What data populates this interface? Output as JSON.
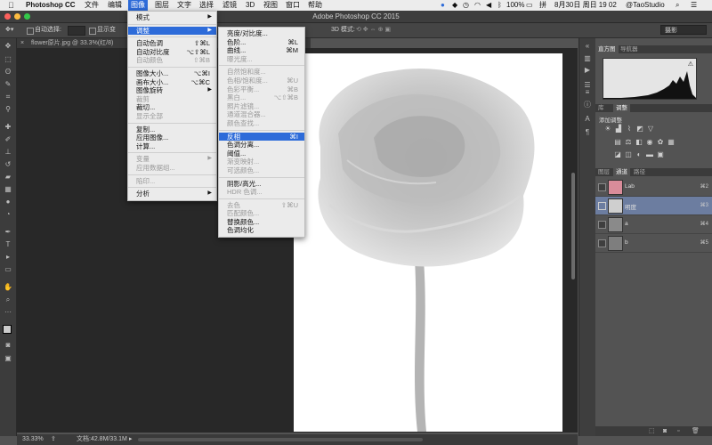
{
  "menubar": {
    "app_name": "Photoshop CC",
    "items": [
      "文件",
      "编辑",
      "图像",
      "图层",
      "文字",
      "选择",
      "滤镜",
      "3D",
      "视图",
      "窗口",
      "帮助"
    ],
    "status_text": "100%",
    "date_time": "8月30日 周日 19 02",
    "user": "@TaoStudio"
  },
  "titlebar": {
    "title": "Adobe Photoshop CC 2015"
  },
  "optionsbar": {
    "auto_select": "自动选择:",
    "show_transform": "显示变",
    "mode_3d": "3D 模式:",
    "workspace": "摄影"
  },
  "document": {
    "tab_label": "flower原片.jpg @ 33.3%(红/8)"
  },
  "statusbar": {
    "zoom": "33.33%",
    "doc_size": "文档:42.8M/33.1M"
  },
  "image_menu": {
    "items": [
      {
        "label": "模式",
        "shortcut": "",
        "submenu": true,
        "disabled": false,
        "sep_after": true
      },
      {
        "label": "调整",
        "shortcut": "",
        "submenu": true,
        "disabled": false,
        "highlight": true,
        "sep_after": true
      },
      {
        "label": "自动色调",
        "shortcut": "⇧⌘L"
      },
      {
        "label": "自动对比度",
        "shortcut": "⌥⇧⌘L"
      },
      {
        "label": "自动颜色",
        "shortcut": "⇧⌘B",
        "disabled": true,
        "sep_after": true
      },
      {
        "label": "图像大小...",
        "shortcut": "⌥⌘I"
      },
      {
        "label": "画布大小...",
        "shortcut": "⌥⌘C"
      },
      {
        "label": "图像旋转",
        "submenu": true
      },
      {
        "label": "裁剪",
        "disabled": true
      },
      {
        "label": "裁切..."
      },
      {
        "label": "显示全部",
        "disabled": true,
        "sep_after": true
      },
      {
        "label": "复制..."
      },
      {
        "label": "应用图像..."
      },
      {
        "label": "计算...",
        "sep_after": true
      },
      {
        "label": "变量",
        "submenu": true,
        "disabled": true
      },
      {
        "label": "应用数据组...",
        "disabled": true,
        "sep_after": true
      },
      {
        "label": "陷印...",
        "disabled": true,
        "sep_after": true
      },
      {
        "label": "分析",
        "submenu": true
      }
    ]
  },
  "adjust_menu": {
    "items": [
      {
        "label": "亮度/对比度..."
      },
      {
        "label": "色阶...",
        "shortcut": "⌘L"
      },
      {
        "label": "曲线...",
        "shortcut": "⌘M"
      },
      {
        "label": "曝光度...",
        "disabled": true,
        "sep_after": true
      },
      {
        "label": "自然饱和度...",
        "disabled": true
      },
      {
        "label": "色相/饱和度...",
        "shortcut": "⌘U",
        "disabled": true
      },
      {
        "label": "色彩平衡...",
        "shortcut": "⌘B",
        "disabled": true
      },
      {
        "label": "黑白...",
        "shortcut": "⌥⇧⌘B",
        "disabled": true
      },
      {
        "label": "照片滤镜...",
        "disabled": true
      },
      {
        "label": "通道混合器...",
        "disabled": true
      },
      {
        "label": "颜色查找...",
        "disabled": true,
        "sep_after": true
      },
      {
        "label": "反相",
        "shortcut": "⌘I",
        "highlight": true
      },
      {
        "label": "色调分离..."
      },
      {
        "label": "阈值..."
      },
      {
        "label": "渐变映射...",
        "disabled": true
      },
      {
        "label": "可选颜色...",
        "disabled": true,
        "sep_after": true
      },
      {
        "label": "阴影/高光..."
      },
      {
        "label": "HDR 色调...",
        "disabled": true,
        "sep_after": true
      },
      {
        "label": "去色",
        "shortcut": "⇧⌘U",
        "disabled": true
      },
      {
        "label": "匹配颜色...",
        "disabled": true
      },
      {
        "label": "替换颜色..."
      },
      {
        "label": "色调均化"
      }
    ]
  },
  "panels": {
    "histogram_tabs": [
      "直方图",
      "导航器"
    ],
    "adjust_tabs": [
      "库",
      "调整"
    ],
    "adjust_title": "添加调整",
    "channel_tabs": [
      "图层",
      "通道",
      "路径"
    ],
    "channels": [
      {
        "name": "Lab",
        "shortcut": "⌘2",
        "selected": false
      },
      {
        "name": "明度",
        "shortcut": "⌘3",
        "selected": true
      },
      {
        "name": "a",
        "shortcut": "⌘4",
        "selected": false
      },
      {
        "name": "b",
        "shortcut": "⌘5",
        "selected": false
      }
    ]
  },
  "colors": {
    "menu_highlight": "#2d6bd9",
    "panel_bg": "#535353",
    "selected_layer": "#6c7da0"
  }
}
